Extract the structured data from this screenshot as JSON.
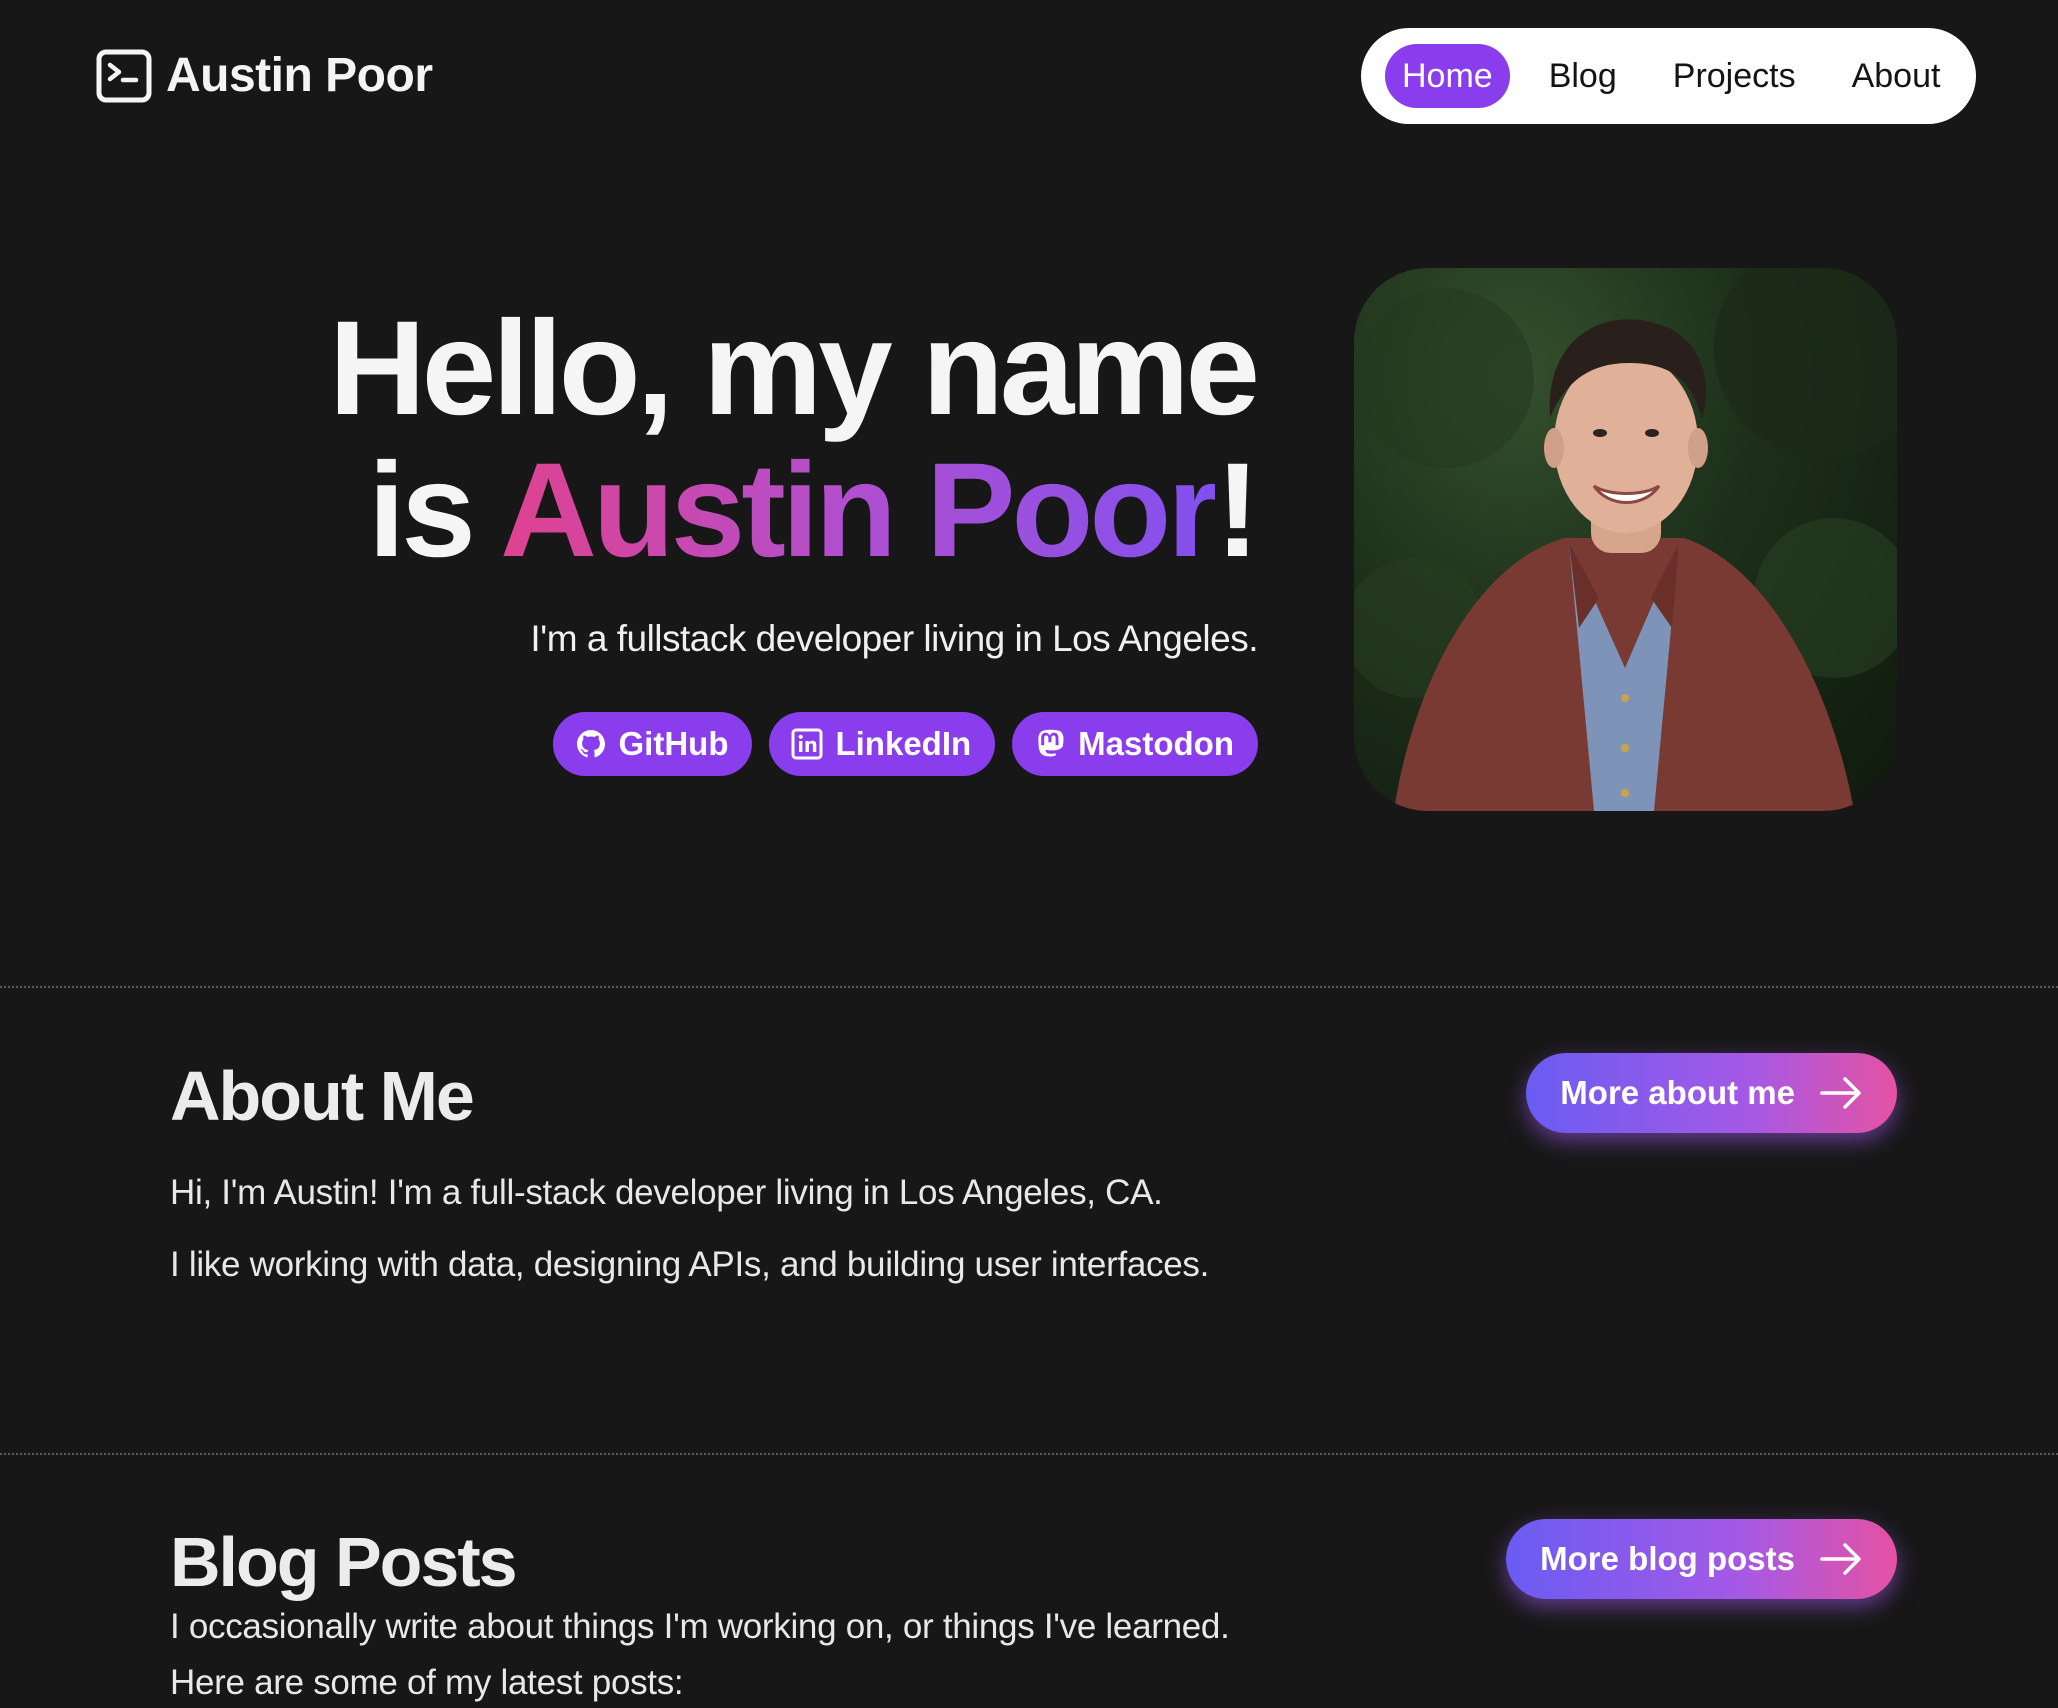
{
  "site": {
    "brand_name": "Austin Poor",
    "brand_icon": "terminal-icon"
  },
  "nav": {
    "items": [
      {
        "label": "Home",
        "active": true
      },
      {
        "label": "Blog",
        "active": false
      },
      {
        "label": "Projects",
        "active": false
      },
      {
        "label": "About",
        "active": false
      }
    ]
  },
  "hero": {
    "title_line1": "Hello, my name",
    "title_is": "is ",
    "title_name": "Austin Poor",
    "title_bang": "!",
    "subtitle": "I'm a fullstack developer living in Los Angeles.",
    "socials": [
      {
        "label": "GitHub",
        "icon": "github-icon"
      },
      {
        "label": "LinkedIn",
        "icon": "linkedin-icon"
      },
      {
        "label": "Mastodon",
        "icon": "mastodon-icon"
      }
    ]
  },
  "about": {
    "title": "About Me",
    "paragraphs": [
      "Hi, I'm Austin! I'm a full-stack developer living in Los Angeles, CA.",
      "I like working with data, designing APIs, and building user interfaces."
    ],
    "cta_label": "More about me"
  },
  "blog": {
    "title": "Blog Posts",
    "paragraphs": [
      "I occasionally write about things I'm working on, or things I've learned.",
      "Here are some of my latest posts:"
    ],
    "cta_label": "More blog posts"
  },
  "colors": {
    "background": "#171717",
    "accent": "#8a3ded",
    "gradient_start": "#e0428f",
    "gradient_end": "#8250ee"
  }
}
